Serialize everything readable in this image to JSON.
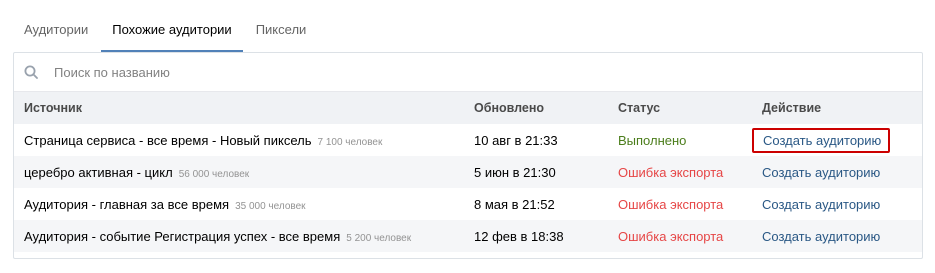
{
  "tabs": [
    {
      "label": "Аудитории",
      "active": false
    },
    {
      "label": "Похожие аудитории",
      "active": true
    },
    {
      "label": "Пиксели",
      "active": false
    }
  ],
  "search": {
    "placeholder": "Поиск по названию",
    "value": ""
  },
  "table": {
    "headers": [
      "Источник",
      "Обновлено",
      "Статус",
      "Действие"
    ],
    "rows": [
      {
        "source": "Страница сервиса - все время - Новый пиксель",
        "count": "7 100 человек",
        "updated": "10 авг в 21:33",
        "status": "Выполнено",
        "action": "Создать аудиторию"
      },
      {
        "source": "церебро активная - цикл",
        "count": "56 000 человек",
        "updated": "5 июн в 21:30",
        "status": "Ошибка экспорта",
        "action": "Создать аудиторию"
      },
      {
        "source": "Аудитория - главная  за все время",
        "count": "35 000 человек",
        "updated": "8 мая в 21:52",
        "status": "Ошибка экспорта",
        "action": "Создать аудиторию"
      },
      {
        "source": "Аудитория - событие Регистрация успех - все время",
        "count": "5 200 человек",
        "updated": "12 фев в 18:38",
        "status": "Ошибка экспорта",
        "action": "Создать аудиторию"
      }
    ]
  },
  "colors": {
    "accent": "#5181b8",
    "link": "#2a5885",
    "success": "#4b7d1b",
    "error": "#e64646",
    "highlight": "#cc0000"
  },
  "icons": {
    "search": "search-icon"
  }
}
